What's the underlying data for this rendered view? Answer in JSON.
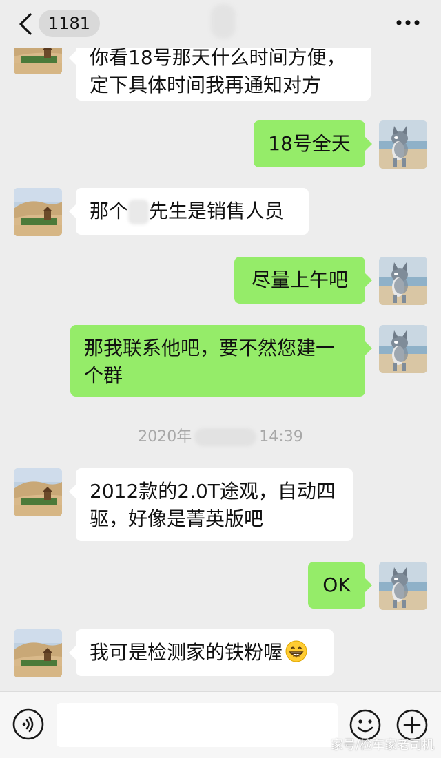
{
  "header": {
    "unread_count": "1181",
    "back_icon": "chevron-left-icon",
    "more_icon": "more-dots-icon"
  },
  "messages": [
    {
      "side": "in",
      "text": "你看18号那天什么时间方便，\n定下具体时间我再通知对方"
    },
    {
      "side": "out",
      "text": "18号全天"
    },
    {
      "side": "in",
      "text_before": "那个",
      "text_after": "先生是销售人员"
    },
    {
      "side": "out",
      "text": "尽量上午吧"
    },
    {
      "side": "out",
      "text": "那我联系他吧，要不然您建一\n个群"
    },
    {
      "side": "in",
      "text": "2012款的2.0T途观，自动四\n驱，好像是菁英版吧"
    },
    {
      "side": "out",
      "text": "OK"
    },
    {
      "side": "in",
      "text": "我可是检测家的铁粉喔",
      "emoji": "grinning-face-icon"
    }
  ],
  "timestamp": {
    "year_prefix": "2020年",
    "time": "14:39"
  },
  "input_bar": {
    "voice_icon": "voice-icon",
    "emoji_icon": "smiley-icon",
    "plus_icon": "plus-circle-icon"
  },
  "watermark": "家号/检车家老司机",
  "colors": {
    "background": "#ededed",
    "incoming_bubble": "#ffffff",
    "outgoing_bubble": "#95ec69"
  }
}
